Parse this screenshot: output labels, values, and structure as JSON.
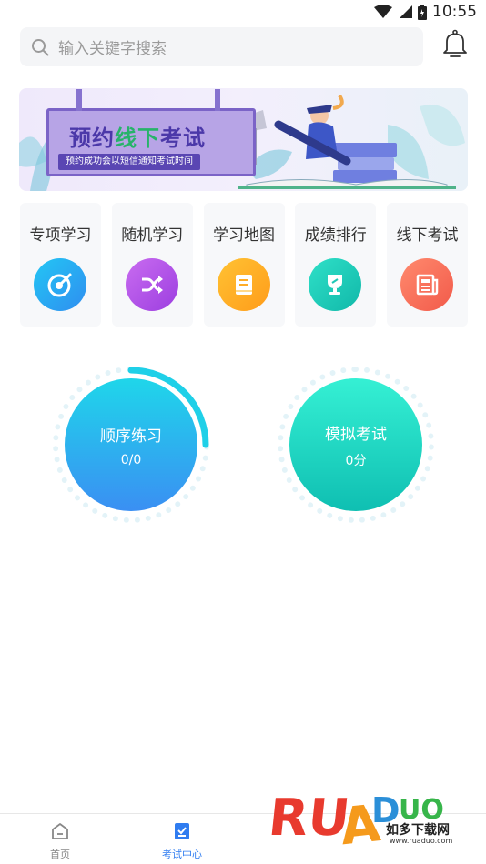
{
  "status_bar": {
    "time": "10:55"
  },
  "search": {
    "placeholder": "输入关键字搜索"
  },
  "banner": {
    "title": "预约线下考试",
    "title_highlight_color": "#27b36a",
    "subtitle": "预约成功会以短信通知考试时间"
  },
  "quick_nav": {
    "items": [
      {
        "label": "专项学习",
        "icon": "target-icon",
        "color_from": "#23c6f4",
        "color_to": "#2f8ef0"
      },
      {
        "label": "随机学习",
        "icon": "shuffle-icon",
        "color_from": "#c96cf0",
        "color_to": "#9c3ee0"
      },
      {
        "label": "学习地图",
        "icon": "book-icon",
        "color_from": "#ffc233",
        "color_to": "#ff9c1a"
      },
      {
        "label": "成绩排行",
        "icon": "trophy-icon",
        "color_from": "#2fe0c8",
        "color_to": "#11b8a9"
      },
      {
        "label": "线下考试",
        "icon": "newspaper-icon",
        "color_from": "#ff8a6e",
        "color_to": "#f25a4a"
      }
    ]
  },
  "practice": {
    "sequential": {
      "title": "顺序练习",
      "value": "0/0",
      "progress": 0.25
    },
    "mock_exam": {
      "title": "模拟考试",
      "value": "0分"
    }
  },
  "tabs": [
    {
      "label": "首页",
      "icon": "home-icon",
      "active": false
    },
    {
      "label": "考试中心",
      "icon": "exam-icon",
      "active": true
    }
  ],
  "colors": {
    "accent": "#2f7cf0",
    "inactive_tab": "#888888"
  },
  "watermark": {
    "brand": "RUANDUO",
    "text": "如多下载网",
    "url": "www.ruaduo.com"
  }
}
